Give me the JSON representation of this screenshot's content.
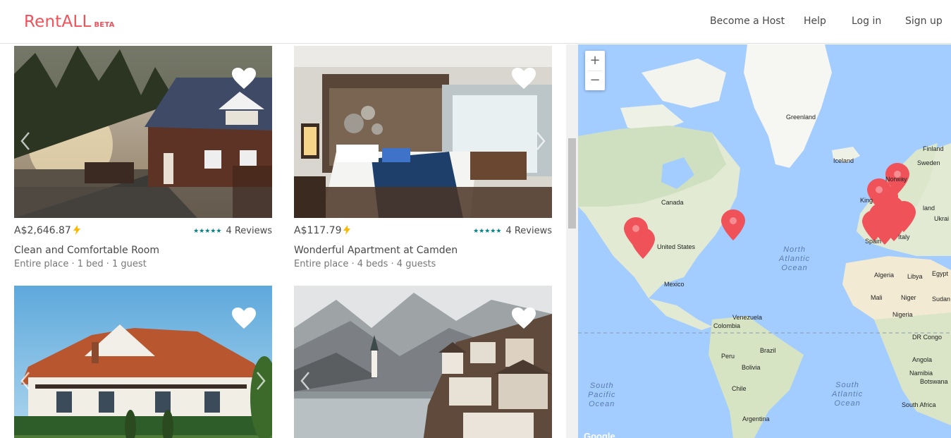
{
  "header": {
    "logo_text": "RentALL",
    "logo_badge": "BETA",
    "nav": [
      "Become a Host",
      "Help",
      "Log in",
      "Sign up"
    ],
    "brand_color": "#f0525a"
  },
  "listings": [
    {
      "price": "A$2,646.87",
      "instant_book": true,
      "rating_stars": 5,
      "reviews": "4 Reviews",
      "title": "Clean and Comfortable Room",
      "details": "Entire place · 1 bed · 1 guest"
    },
    {
      "price": "A$117.79",
      "instant_book": true,
      "rating_stars": 5,
      "reviews": "4 Reviews",
      "title": "Wonderful Apartment at Camden",
      "details": "Entire place · 4 beds · 4 guests"
    },
    {
      "price": "",
      "title": "",
      "details": ""
    },
    {
      "price": "",
      "title": "",
      "details": ""
    }
  ],
  "map": {
    "zoom_in": "+",
    "zoom_out": "−",
    "labels": {
      "greenland": "Greenland",
      "iceland": "Iceland",
      "finland": "Finland",
      "sweden": "Sweden",
      "norway": "Norway",
      "canada": "Canada",
      "united_states": "United States",
      "mexico": "Mexico",
      "venezuela": "Venezuela",
      "colombia": "Colombia",
      "brazil": "Brazil",
      "peru": "Peru",
      "bolivia": "Bolivia",
      "chile": "Chile",
      "argentina": "Argentina",
      "algeria": "Algeria",
      "libya": "Libya",
      "egypt": "Egypt",
      "mali": "Mali",
      "niger": "Niger",
      "nigeria": "Nigeria",
      "sudan": "Sudan",
      "dr_congo": "DR Congo",
      "angola": "Angola",
      "namibia": "Namibia",
      "botswana": "Botswana",
      "south_africa": "South Africa",
      "spain": "Spain",
      "italy": "Italy",
      "ukraine": "Ukrai",
      "poland": "land",
      "kingdom": "King",
      "google": "Google"
    },
    "oceans": {
      "north_atlantic": [
        "North",
        "Atlantic",
        "Ocean"
      ],
      "south_pacific": [
        "South",
        "Pacific",
        "Ocean"
      ],
      "south_atlantic": [
        "South",
        "Atlantic",
        "Ocean"
      ]
    },
    "pin_color": "#f0525a",
    "pin_count": 12
  }
}
